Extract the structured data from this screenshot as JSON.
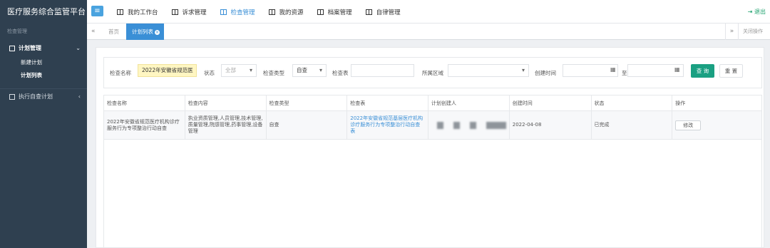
{
  "app": {
    "title": "医疗服务综合监管平台",
    "logout_label": "退出"
  },
  "topnav": [
    {
      "label": "我的工作台",
      "active": false
    },
    {
      "label": "诉求管理",
      "active": false
    },
    {
      "label": "检查管理",
      "active": true
    },
    {
      "label": "我的资源",
      "active": false
    },
    {
      "label": "档案管理",
      "active": false
    },
    {
      "label": "自律管理",
      "active": false
    }
  ],
  "sidebar": {
    "header": "检查管理",
    "group1": {
      "label": "计划管理",
      "items": [
        "新建计划",
        "计划列表"
      ]
    },
    "group2": {
      "label": "执行自查计划"
    }
  },
  "tabs": {
    "home": "首页",
    "active": "计划列表",
    "close_ops": "关闭操作"
  },
  "form": {
    "name_label": "检查名称",
    "name_value": "2022年安徽省规范医",
    "status_label": "状态",
    "status_value": "全部",
    "type_label": "检查类型",
    "type_value": "自查",
    "table_label": "检查表",
    "table_value": "",
    "region_label": "所属区域",
    "region_value": "",
    "created_label": "创建时间",
    "to_label": "至",
    "search_label": "查 询",
    "reset_label": "重 置"
  },
  "table": {
    "headers": [
      "检查名称",
      "检查内容",
      "检查类型",
      "检查表",
      "计划创建人",
      "创建时间",
      "状态",
      "操作"
    ],
    "rows": [
      {
        "name": "2022年安徽省规范医疗机构诊疗服务行为专项整治行动自查",
        "content": "执业资质管理,人员管理,技术管理,质量管理,院感管理,药事管理,设备管理",
        "type": "自查",
        "sheet": "2022年安徽省规范基层医疗机构诊疗服务行为专项整治行动自查表",
        "created": "2022-04-08",
        "status": "已完成",
        "action": "修改"
      }
    ]
  }
}
